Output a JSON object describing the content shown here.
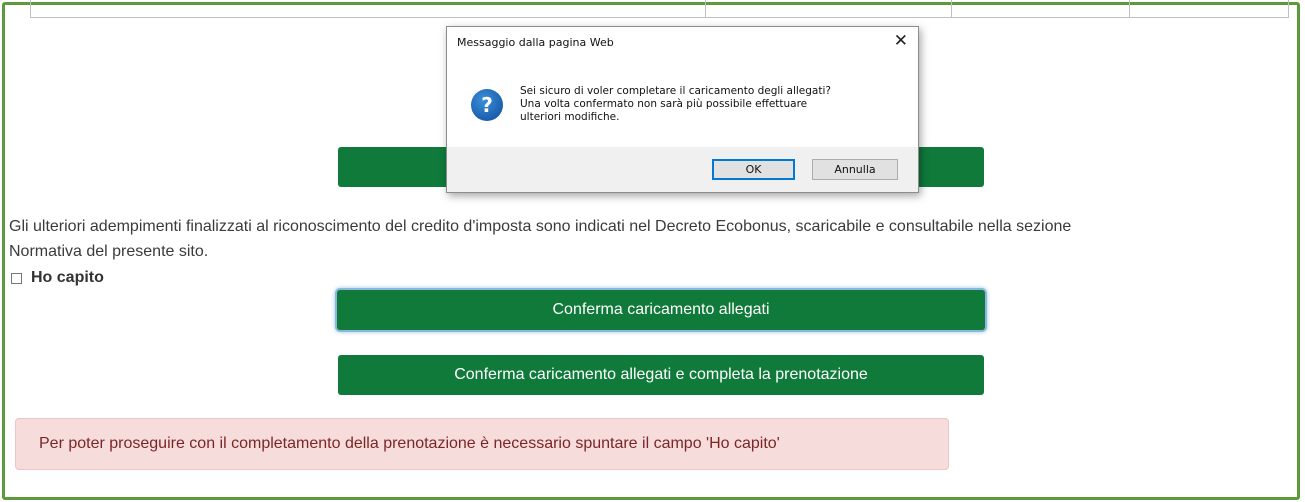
{
  "page": {
    "hidden_button_label": "",
    "info_text_line1": "Gli ulteriori adempimenti finalizzati al riconoscimento del credito d'imposta sono indicati nel Decreto Ecobonus, scaricabile e consultabile nella sezione",
    "info_text_line2": "Normativa del presente sito.",
    "ack_label": "Ho capito",
    "ack_checked": false,
    "confirm_upload_label": "Conferma caricamento allegati",
    "confirm_and_complete_label": "Conferma caricamento allegati e completa la prenotazione",
    "alert_text": "Per poter proseguire con il completamento della prenotazione è necessario spuntare il campo 'Ho capito'"
  },
  "dialog": {
    "title": "Messaggio dalla pagina Web",
    "close_glyph": "✕",
    "icon": "question-icon",
    "icon_glyph": "?",
    "message_line1": "Sei sicuro di voler completare il caricamento degli allegati?",
    "message_line2": "Una volta confermato non sarà più possibile effettuare",
    "message_line3": "ulteriori modifiche.",
    "ok_label": "OK",
    "cancel_label": "Annulla"
  },
  "colors": {
    "primary_green": "#0f7a3a",
    "frame_green": "#5c9a3c",
    "alert_bg": "#f7dcdc",
    "alert_text": "#7b2626",
    "focus_ring": "#8ab8dd"
  }
}
